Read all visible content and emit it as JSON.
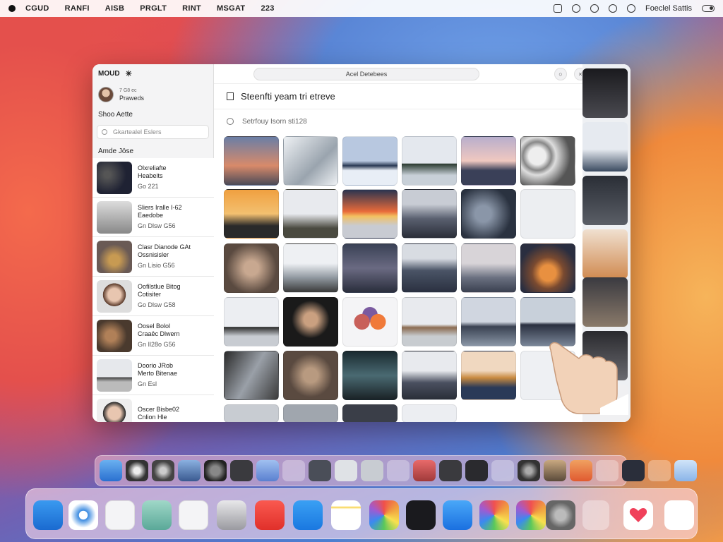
{
  "menubar": {
    "items": [
      "CGUD",
      "RANFI",
      "AISB",
      "PRGLT",
      "RINT",
      "MSGAT",
      "223"
    ],
    "status_text": "Foeclel Sattis"
  },
  "window": {
    "sidebar": {
      "header": "MOUD",
      "user_line1": "7 G8 ec",
      "user_line2": "Praweds",
      "section1": "Shoo Aette",
      "search_placeholder": "Gkartealel Eslers",
      "section2": "Amde Jöse",
      "items": [
        {
          "title": "Olxreliafte",
          "title2": "Heabeits",
          "sub": "Go 221"
        },
        {
          "title": "Sliers Iralle I-62",
          "title2": "Eaedobe",
          "sub": "Gn Dlsw G56"
        },
        {
          "title": "Clasr Dianode GAt",
          "title2": "Ossnisisler",
          "sub": "Gn Lisio G56"
        },
        {
          "title": "Oofilstlue Bitog",
          "title2": "Cotisiter",
          "sub": "Go Dlsw G58"
        },
        {
          "title": "Oosel Bolol",
          "title2": "Craaêc Dlwern",
          "sub": "Gn Il28o G56"
        },
        {
          "title": "Doorio JRob",
          "title2": "Merto Bitenae",
          "sub": "Gn Esl"
        },
        {
          "title": "Oscer Bisbe02",
          "title2": "Cnlion Hle",
          "sub": ""
        }
      ]
    },
    "main": {
      "url": "Acel Detebees",
      "title": "Steenfti yeam tri etreve",
      "search_placeholder": "Setrfouy Isorn sti128"
    }
  }
}
